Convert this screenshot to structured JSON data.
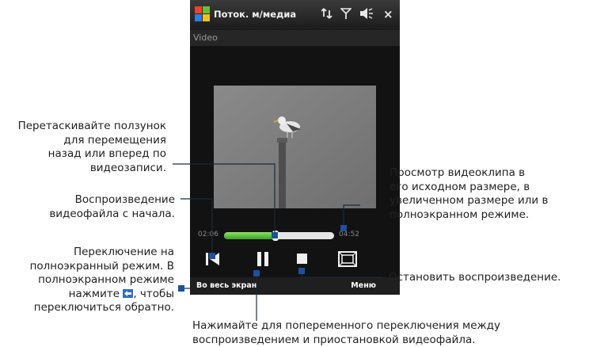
{
  "titlebar": {
    "app_title": "Поток. м/медиа",
    "icons": [
      "windows-start-icon",
      "signal-sync-icon",
      "antenna-icon",
      "volume-icon",
      "close-icon"
    ],
    "close_glyph": "×"
  },
  "subtitle": "Video",
  "player": {
    "elapsed": "02:06",
    "total": "04:52",
    "progress": 0.47,
    "accent_color": "#3aa51c",
    "controls": [
      "skip-to-start-icon",
      "pause-icon",
      "stop-icon",
      "original-size-icon"
    ]
  },
  "softkeys": {
    "left": "Во весь экран",
    "right": "Меню"
  },
  "annotations": {
    "drag_slider": [
      "Перетаскивайте ползунок",
      "для перемещения",
      "назад или вперед по",
      "видеозаписи."
    ],
    "play_from_start": [
      "Воспроизведение",
      "видеофайла с начала."
    ],
    "fullscreen": [
      "Переключение на",
      "полноэкранный режим. В",
      "полноэкранном режиме",
      "нажмите",
      ", чтобы",
      "переключиться обратно."
    ],
    "view_size": [
      "Просмотр видеоклипа в",
      "его исходном размере, в",
      "увеличенном размере или в",
      "полноэкранном режиме."
    ],
    "stop": "Остановить воспроизведение.",
    "pause_toggle": [
      "Нажимайте для попеременного переключения между",
      "воспроизведением и приостановкой видеофайла."
    ]
  }
}
